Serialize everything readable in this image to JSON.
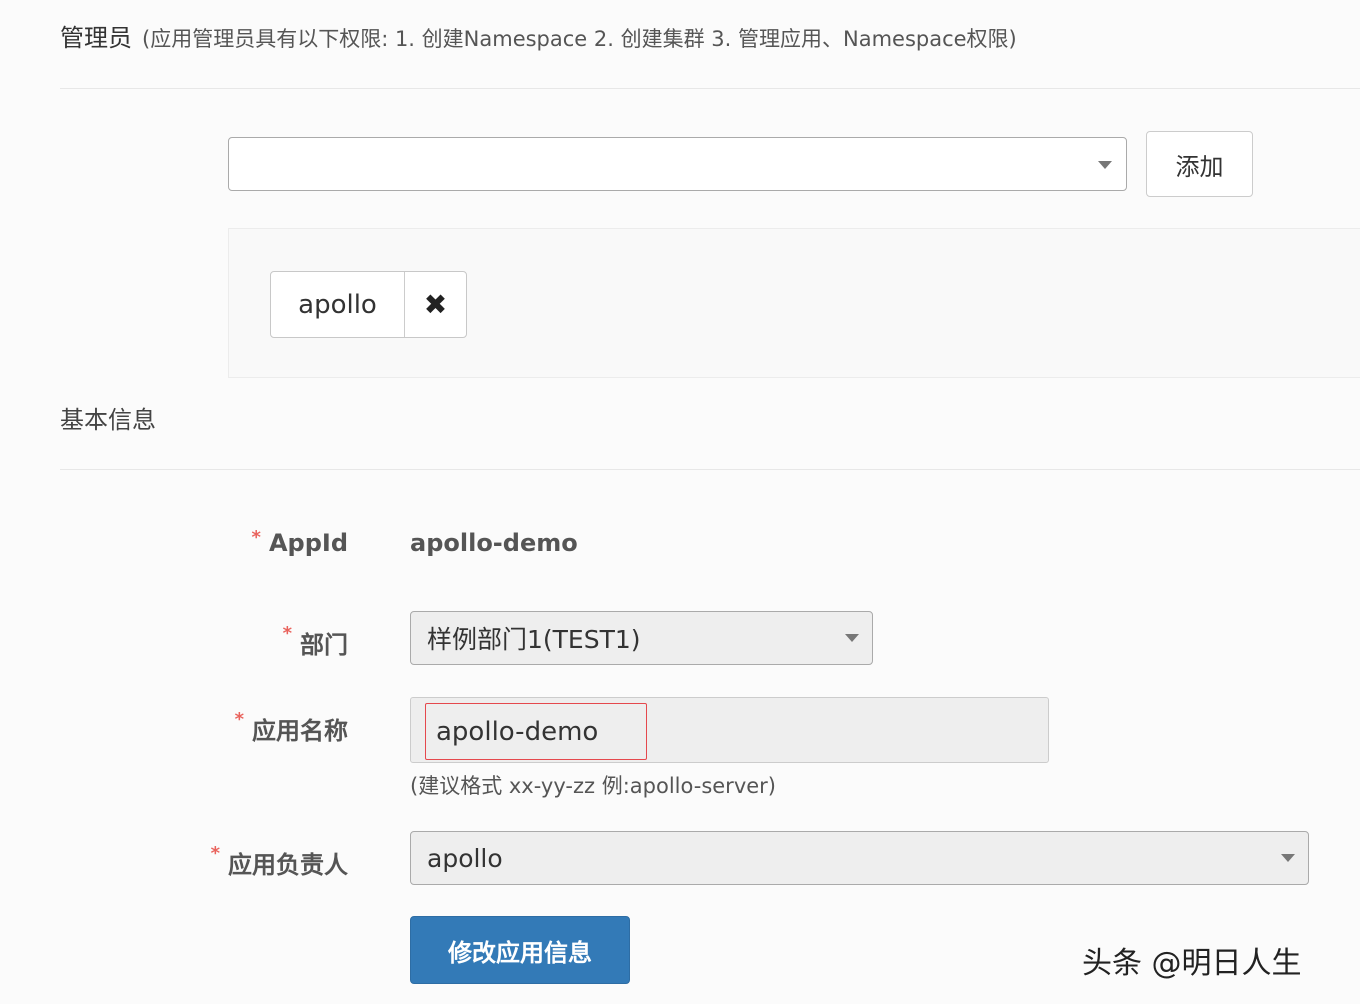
{
  "admin_section": {
    "title": "管理员",
    "description": "(应用管理员具有以下权限: 1. 创建Namespace 2. 创建集群 3. 管理应用、Namespace权限)",
    "user_select_value": "",
    "add_button": "添加",
    "admins": [
      {
        "name": "apollo",
        "remove_icon": "✖"
      }
    ]
  },
  "basic_info": {
    "title": "基本信息",
    "required_mark": "*",
    "app_id": {
      "label": "AppId",
      "value": "apollo-demo"
    },
    "department": {
      "label": "部门",
      "value": "样例部门1(TEST1)"
    },
    "app_name": {
      "label": "应用名称",
      "value": "apollo-demo",
      "help": "(建议格式 xx-yy-zz 例:apollo-server)"
    },
    "owner": {
      "label": "应用负责人",
      "value": "apollo"
    },
    "submit_button": "修改应用信息"
  },
  "watermark": "头条 @明日人生",
  "colors": {
    "primary": "#337ab7",
    "required": "#e9635d",
    "input_error_border": "#e5484d"
  }
}
